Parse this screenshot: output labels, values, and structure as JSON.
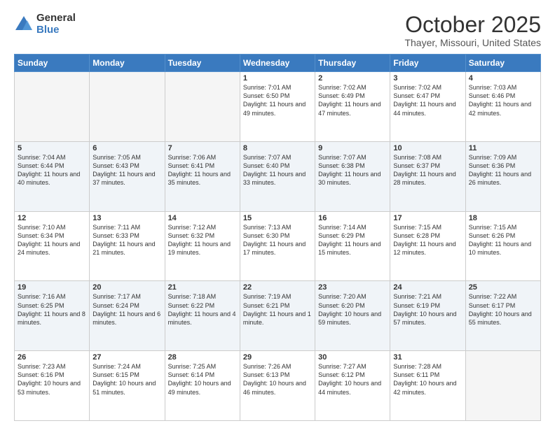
{
  "header": {
    "logo_general": "General",
    "logo_blue": "Blue",
    "month_title": "October 2025",
    "location": "Thayer, Missouri, United States"
  },
  "days_of_week": [
    "Sunday",
    "Monday",
    "Tuesday",
    "Wednesday",
    "Thursday",
    "Friday",
    "Saturday"
  ],
  "weeks": [
    [
      {
        "day": "",
        "info": ""
      },
      {
        "day": "",
        "info": ""
      },
      {
        "day": "",
        "info": ""
      },
      {
        "day": "1",
        "info": "Sunrise: 7:01 AM\nSunset: 6:50 PM\nDaylight: 11 hours and 49 minutes."
      },
      {
        "day": "2",
        "info": "Sunrise: 7:02 AM\nSunset: 6:49 PM\nDaylight: 11 hours and 47 minutes."
      },
      {
        "day": "3",
        "info": "Sunrise: 7:02 AM\nSunset: 6:47 PM\nDaylight: 11 hours and 44 minutes."
      },
      {
        "day": "4",
        "info": "Sunrise: 7:03 AM\nSunset: 6:46 PM\nDaylight: 11 hours and 42 minutes."
      }
    ],
    [
      {
        "day": "5",
        "info": "Sunrise: 7:04 AM\nSunset: 6:44 PM\nDaylight: 11 hours and 40 minutes."
      },
      {
        "day": "6",
        "info": "Sunrise: 7:05 AM\nSunset: 6:43 PM\nDaylight: 11 hours and 37 minutes."
      },
      {
        "day": "7",
        "info": "Sunrise: 7:06 AM\nSunset: 6:41 PM\nDaylight: 11 hours and 35 minutes."
      },
      {
        "day": "8",
        "info": "Sunrise: 7:07 AM\nSunset: 6:40 PM\nDaylight: 11 hours and 33 minutes."
      },
      {
        "day": "9",
        "info": "Sunrise: 7:07 AM\nSunset: 6:38 PM\nDaylight: 11 hours and 30 minutes."
      },
      {
        "day": "10",
        "info": "Sunrise: 7:08 AM\nSunset: 6:37 PM\nDaylight: 11 hours and 28 minutes."
      },
      {
        "day": "11",
        "info": "Sunrise: 7:09 AM\nSunset: 6:36 PM\nDaylight: 11 hours and 26 minutes."
      }
    ],
    [
      {
        "day": "12",
        "info": "Sunrise: 7:10 AM\nSunset: 6:34 PM\nDaylight: 11 hours and 24 minutes."
      },
      {
        "day": "13",
        "info": "Sunrise: 7:11 AM\nSunset: 6:33 PM\nDaylight: 11 hours and 21 minutes."
      },
      {
        "day": "14",
        "info": "Sunrise: 7:12 AM\nSunset: 6:32 PM\nDaylight: 11 hours and 19 minutes."
      },
      {
        "day": "15",
        "info": "Sunrise: 7:13 AM\nSunset: 6:30 PM\nDaylight: 11 hours and 17 minutes."
      },
      {
        "day": "16",
        "info": "Sunrise: 7:14 AM\nSunset: 6:29 PM\nDaylight: 11 hours and 15 minutes."
      },
      {
        "day": "17",
        "info": "Sunrise: 7:15 AM\nSunset: 6:28 PM\nDaylight: 11 hours and 12 minutes."
      },
      {
        "day": "18",
        "info": "Sunrise: 7:15 AM\nSunset: 6:26 PM\nDaylight: 11 hours and 10 minutes."
      }
    ],
    [
      {
        "day": "19",
        "info": "Sunrise: 7:16 AM\nSunset: 6:25 PM\nDaylight: 11 hours and 8 minutes."
      },
      {
        "day": "20",
        "info": "Sunrise: 7:17 AM\nSunset: 6:24 PM\nDaylight: 11 hours and 6 minutes."
      },
      {
        "day": "21",
        "info": "Sunrise: 7:18 AM\nSunset: 6:22 PM\nDaylight: 11 hours and 4 minutes."
      },
      {
        "day": "22",
        "info": "Sunrise: 7:19 AM\nSunset: 6:21 PM\nDaylight: 11 hours and 1 minute."
      },
      {
        "day": "23",
        "info": "Sunrise: 7:20 AM\nSunset: 6:20 PM\nDaylight: 10 hours and 59 minutes."
      },
      {
        "day": "24",
        "info": "Sunrise: 7:21 AM\nSunset: 6:19 PM\nDaylight: 10 hours and 57 minutes."
      },
      {
        "day": "25",
        "info": "Sunrise: 7:22 AM\nSunset: 6:17 PM\nDaylight: 10 hours and 55 minutes."
      }
    ],
    [
      {
        "day": "26",
        "info": "Sunrise: 7:23 AM\nSunset: 6:16 PM\nDaylight: 10 hours and 53 minutes."
      },
      {
        "day": "27",
        "info": "Sunrise: 7:24 AM\nSunset: 6:15 PM\nDaylight: 10 hours and 51 minutes."
      },
      {
        "day": "28",
        "info": "Sunrise: 7:25 AM\nSunset: 6:14 PM\nDaylight: 10 hours and 49 minutes."
      },
      {
        "day": "29",
        "info": "Sunrise: 7:26 AM\nSunset: 6:13 PM\nDaylight: 10 hours and 46 minutes."
      },
      {
        "day": "30",
        "info": "Sunrise: 7:27 AM\nSunset: 6:12 PM\nDaylight: 10 hours and 44 minutes."
      },
      {
        "day": "31",
        "info": "Sunrise: 7:28 AM\nSunset: 6:11 PM\nDaylight: 10 hours and 42 minutes."
      },
      {
        "day": "",
        "info": ""
      }
    ]
  ]
}
